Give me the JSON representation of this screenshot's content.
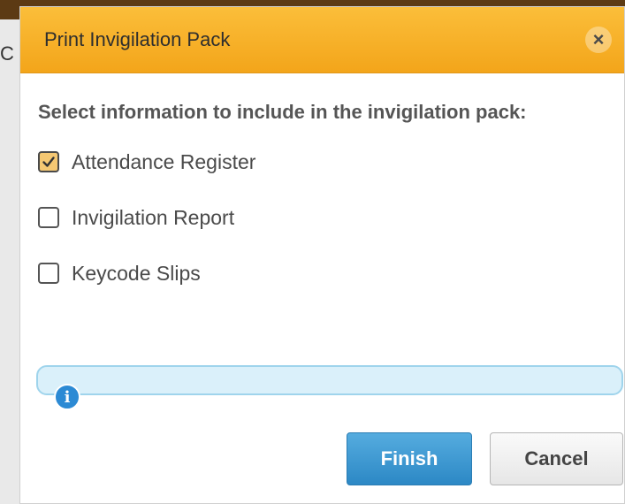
{
  "background": {
    "edge_letter": "C"
  },
  "dialog": {
    "title": "Print Invigilation Pack",
    "close_symbol": "×",
    "instruction": "Select information to include in the invigilation pack:",
    "options": [
      {
        "label": "Attendance Register",
        "checked": true
      },
      {
        "label": "Invigilation Report",
        "checked": false
      },
      {
        "label": "Keycode Slips",
        "checked": false
      }
    ],
    "info_symbol": "i",
    "buttons": {
      "finish": "Finish",
      "cancel": "Cancel"
    }
  },
  "colors": {
    "titlebar": "#f7b32b",
    "primary_button": "#3a97d4",
    "info_bar": "#daf0fa",
    "checked_fill": "#f5c873"
  }
}
